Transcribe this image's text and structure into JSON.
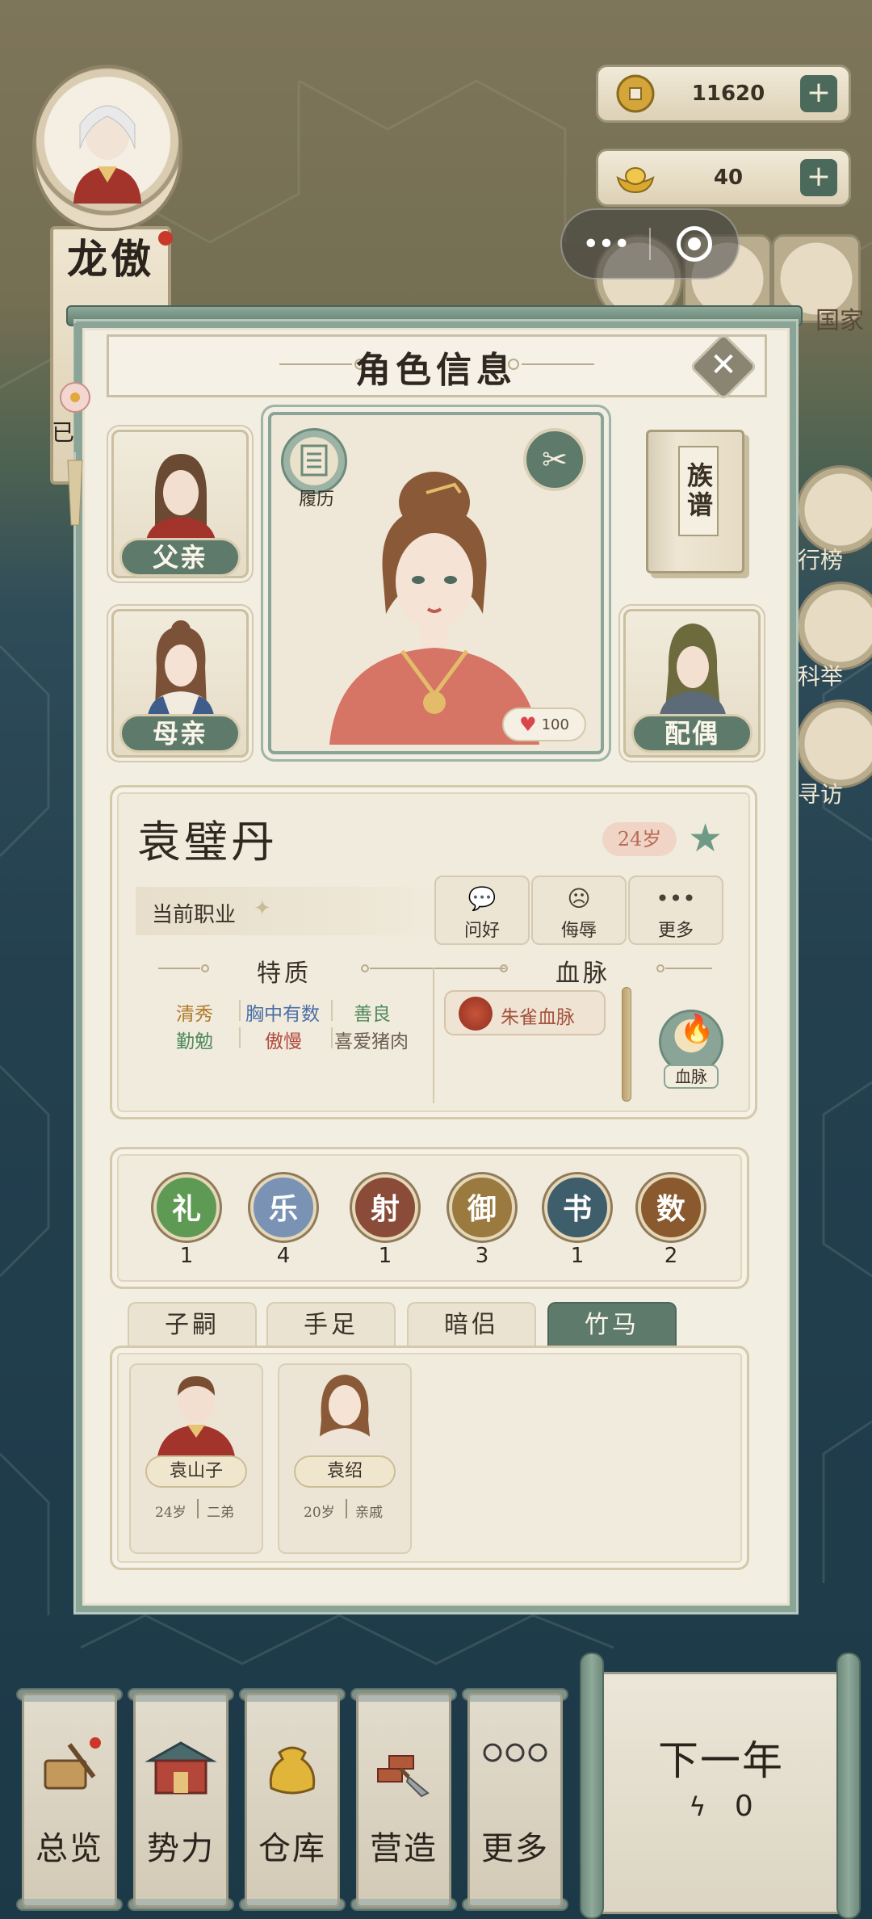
{
  "resources": {
    "coins": "11620",
    "gold": "40",
    "plus": "+"
  },
  "capsule": {
    "more": "•••"
  },
  "lord": {
    "name": "龙傲",
    "status": "已"
  },
  "side_menu": [
    "行榜",
    "科举",
    "寻访",
    "国家"
  ],
  "panel": {
    "title": "角色信息",
    "close": "✕"
  },
  "family": {
    "father": "父亲",
    "mother": "母亲",
    "spouse": "配偶",
    "genealogy": "族谱"
  },
  "portrait": {
    "resume": "履历",
    "heart_value": "100"
  },
  "character": {
    "name": "袁璧丹",
    "age": "24岁",
    "job_label": "当前职业"
  },
  "actions": [
    {
      "icon": "chat-bubble-icon",
      "label": "问好"
    },
    {
      "icon": "angry-face-icon",
      "label": "侮辱"
    },
    {
      "icon": "more-dots-icon",
      "label": "更多"
    }
  ],
  "traits": {
    "title": "特质",
    "items": [
      {
        "text": "清秀",
        "color": "#b07a2a"
      },
      {
        "text": "胸中有数",
        "color": "#4a6fa6"
      },
      {
        "text": "善良",
        "color": "#4e8a5e"
      },
      {
        "text": "勤勉",
        "color": "#4e8a5e"
      },
      {
        "text": "傲慢",
        "color": "#b04a3e"
      },
      {
        "text": "喜爱猪肉",
        "color": "#6b5f50"
      }
    ]
  },
  "bloodline": {
    "title": "血脉",
    "item": "朱雀血脉",
    "button": "血脉"
  },
  "stats": [
    {
      "name": "礼",
      "value": "1",
      "color": "#5f9a55"
    },
    {
      "name": "乐",
      "value": "4",
      "color": "#7a93b5"
    },
    {
      "name": "射",
      "value": "1",
      "color": "#8a4b38"
    },
    {
      "name": "御",
      "value": "3",
      "color": "#9a7a3e"
    },
    {
      "name": "书",
      "value": "1",
      "color": "#3f5e6b"
    },
    {
      "name": "数",
      "value": "2",
      "color": "#8a5a2e"
    }
  ],
  "tabs": [
    "子嗣",
    "手足",
    "暗侣",
    "竹马"
  ],
  "active_tab": "竹马",
  "kin": [
    {
      "name": "袁山子",
      "age": "24岁",
      "relation": "二弟"
    },
    {
      "name": "袁绍",
      "age": "20岁",
      "relation": "亲戚"
    }
  ],
  "bottom_nav": [
    {
      "label": "总览",
      "icon": "scroll-brush-icon"
    },
    {
      "label": "势力",
      "icon": "palace-icon"
    },
    {
      "label": "仓库",
      "icon": "money-bag-icon"
    },
    {
      "label": "营造",
      "icon": "trowel-bricks-icon"
    },
    {
      "label": "更多",
      "icon": "more-circles-icon"
    }
  ],
  "next_year": {
    "label": "下一年",
    "energy": "0"
  }
}
